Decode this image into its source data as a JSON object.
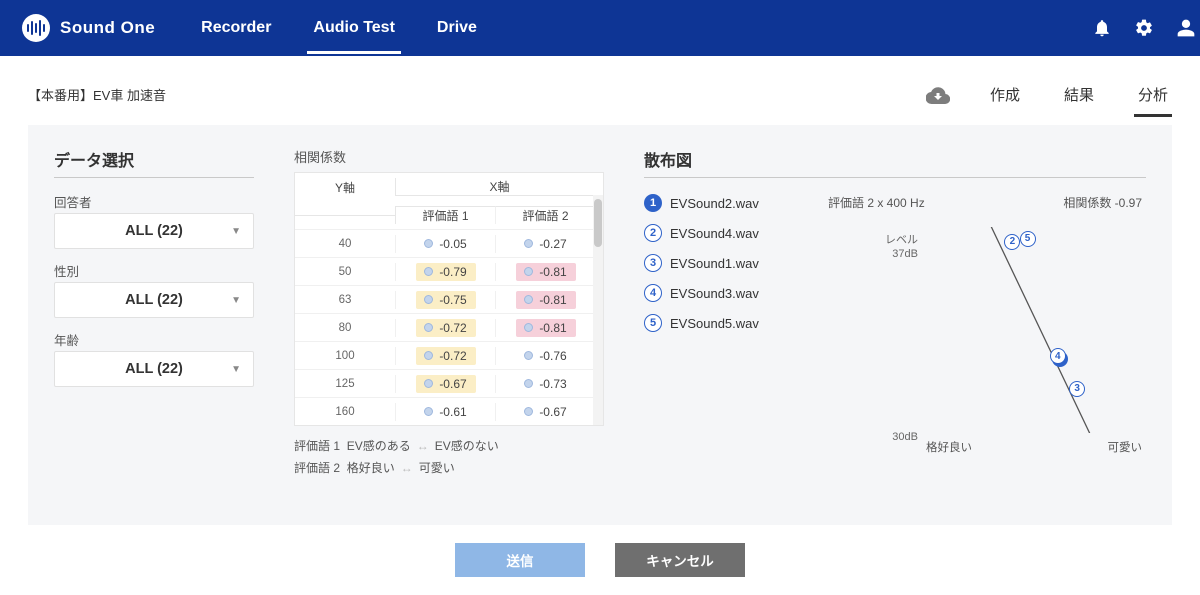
{
  "brand": "Sound One",
  "nav": {
    "items": [
      "Recorder",
      "Audio Test",
      "Drive"
    ],
    "active": 1
  },
  "breadcrumb": "【本番用】EV車 加速音",
  "subnav": {
    "items": [
      "作成",
      "結果",
      "分析"
    ],
    "active": 2
  },
  "filters": {
    "section_title": "データ選択",
    "fields": [
      {
        "label": "回答者",
        "value": "ALL (22)"
      },
      {
        "label": "性別",
        "value": "ALL (22)"
      },
      {
        "label": "年齢",
        "value": "ALL (22)"
      }
    ]
  },
  "corr": {
    "title": "相関係数",
    "y_axis_label": "Y軸",
    "x_axis_label": "X軸",
    "cols": [
      "評価語 1",
      "評価語 2"
    ],
    "rows": [
      {
        "y": "40",
        "v": [
          "-0.05",
          "-0.27"
        ],
        "style": [
          "",
          ""
        ]
      },
      {
        "y": "50",
        "v": [
          "-0.79",
          "-0.81"
        ],
        "style": [
          "y",
          "p"
        ]
      },
      {
        "y": "63",
        "v": [
          "-0.75",
          "-0.81"
        ],
        "style": [
          "y",
          "p"
        ]
      },
      {
        "y": "80",
        "v": [
          "-0.72",
          "-0.81"
        ],
        "style": [
          "y",
          "p"
        ]
      },
      {
        "y": "100",
        "v": [
          "-0.72",
          "-0.76"
        ],
        "style": [
          "y",
          ""
        ]
      },
      {
        "y": "125",
        "v": [
          "-0.67",
          "-0.73"
        ],
        "style": [
          "y",
          ""
        ]
      },
      {
        "y": "160",
        "v": [
          "-0.61",
          "-0.67"
        ],
        "style": [
          "",
          ""
        ]
      }
    ],
    "legend": [
      {
        "key": "評価語 1",
        "left": "EV感のある",
        "right": "EV感のない"
      },
      {
        "key": "評価語 2",
        "left": "格好良い",
        "right": "可愛い"
      }
    ]
  },
  "scatter": {
    "title": "散布図",
    "sounds": [
      {
        "n": 1,
        "label": "EVSound2.wav",
        "selected": true
      },
      {
        "n": 2,
        "label": "EVSound4.wav",
        "selected": false
      },
      {
        "n": 3,
        "label": "EVSound1.wav",
        "selected": false
      },
      {
        "n": 4,
        "label": "EVSound3.wav",
        "selected": false
      },
      {
        "n": 5,
        "label": "EVSound5.wav",
        "selected": false
      }
    ],
    "meta_left": "評価語 2 x 400 Hz",
    "meta_right": "相関係数 -0.97",
    "y_top_lines": [
      "レベル",
      "37dB"
    ],
    "y_bottom": "30dB",
    "x_left": "格好良い",
    "x_right": "可愛い"
  },
  "buttons": {
    "submit": "送信",
    "cancel": "キャンセル"
  },
  "chart_data": {
    "type": "scatter",
    "title": "評価語 2 x 400 Hz",
    "xlabel_left": "格好良い",
    "xlabel_right": "可愛い",
    "ylabel": "レベル (dB)",
    "ylim": [
      30,
      37
    ],
    "correlation": -0.97,
    "points": [
      {
        "id": 1,
        "label": "EVSound2.wav",
        "x": 0.62,
        "y": 32.5,
        "selected": true
      },
      {
        "id": 2,
        "label": "EVSound4.wav",
        "x": 0.4,
        "y": 36.5,
        "selected": false
      },
      {
        "id": 3,
        "label": "EVSound1.wav",
        "x": 0.7,
        "y": 31.5,
        "selected": false
      },
      {
        "id": 4,
        "label": "EVSound3.wav",
        "x": 0.61,
        "y": 32.6,
        "selected": false
      },
      {
        "id": 5,
        "label": "EVSound5.wav",
        "x": 0.47,
        "y": 36.6,
        "selected": false
      }
    ]
  }
}
